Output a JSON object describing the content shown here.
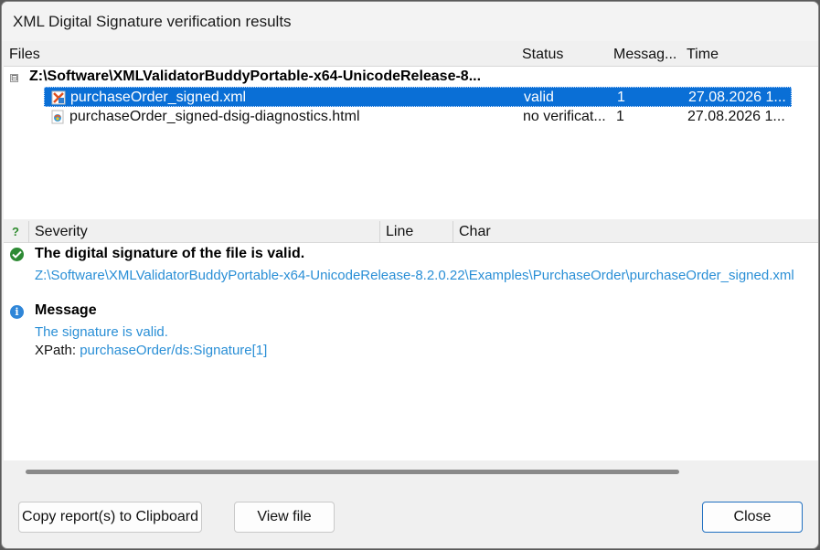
{
  "window": {
    "title": "XML Digital Signature verification results"
  },
  "files": {
    "columns": {
      "files": "Files",
      "status": "Status",
      "messages": "Messag...",
      "time": "Time"
    },
    "root": {
      "expander": "⊟",
      "label": "Z:\\Software\\XMLValidatorBuddyPortable-x64-UnicodeRelease-8..."
    },
    "rows": [
      {
        "name": "purchaseOrder_signed.xml",
        "status": "valid",
        "messages": "1",
        "time": "27.08.2026 1...",
        "icon": "xml-file-icon",
        "selected": true
      },
      {
        "name": "purchaseOrder_signed-dsig-diagnostics.html",
        "status": "no verificat...",
        "messages": "1",
        "time": "27.08.2026 1...",
        "icon": "html-file-icon",
        "selected": false
      }
    ]
  },
  "messages": {
    "columns": {
      "icon": "?",
      "severity": "Severity",
      "line": "Line",
      "char": "Char"
    },
    "entries": [
      {
        "icon": "check-circle-icon",
        "title": "The digital signature of the file is valid.",
        "path": "Z:\\Software\\XMLValidatorBuddyPortable-x64-UnicodeRelease-8.2.0.22\\Examples\\PurchaseOrder\\purchaseOrder_signed.xml"
      },
      {
        "icon": "info-icon",
        "title": "Message",
        "text": "The signature is valid.",
        "xpath_label": "XPath:",
        "xpath_value": "purchaseOrder/ds:Signature[1]"
      }
    ]
  },
  "buttons": {
    "copy": "Copy report(s) to Clipboard",
    "view": "View file",
    "close": "Close"
  },
  "colors": {
    "selection": "#0a6fd6",
    "link": "#2a8fd6",
    "ok": "#2d8a34",
    "info": "#2f86d8"
  }
}
